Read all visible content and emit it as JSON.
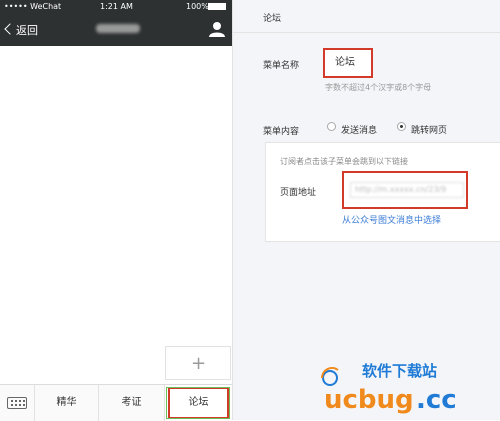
{
  "status_bar": {
    "carrier": "••••• WeChat",
    "time": "1:21 AM",
    "battery": "100%"
  },
  "nav": {
    "back_label": "返回",
    "title": ""
  },
  "menu": {
    "add_symbol": "+",
    "items": [
      {
        "label": "精华"
      },
      {
        "label": "考证"
      },
      {
        "label": "论坛"
      }
    ]
  },
  "panel": {
    "header_title": "论坛",
    "name_label": "菜单名称",
    "name_value": "论坛",
    "name_hint": "字数不超过4个汉字或8个字母",
    "content_label": "菜单内容",
    "option_send": "发送消息",
    "option_jump": "跳转网页",
    "selected_option": "跳转网页",
    "card_desc": "订阅者点击该子菜单会跳到以下链接",
    "url_label": "页面地址",
    "url_value": "http://m.xxxxx.cn/23/9",
    "pick_link": "从公众号图文消息中选择"
  },
  "watermark": {
    "text": "软件下载站",
    "brand": "ucbug.cc"
  },
  "colors": {
    "highlight": "#d23a2a",
    "active_menu": "#6bbf59",
    "nav_bg": "#2e3132",
    "link": "#3a7bd5",
    "brand_orange": "#f08a1c",
    "brand_blue": "#1f7bd6"
  }
}
